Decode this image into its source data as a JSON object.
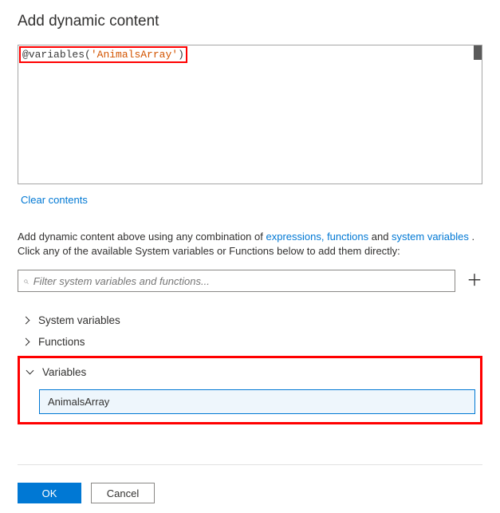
{
  "header": {
    "title": "Add dynamic content"
  },
  "editor": {
    "expression_prefix": "@",
    "expression_func": "variables",
    "expression_open": "(",
    "expression_arg": "'AnimalsArray'",
    "expression_close": ")"
  },
  "actions": {
    "clear_label": "Clear contents"
  },
  "info": {
    "text_before_links": "Add dynamic content above using any combination of ",
    "expressions_link": "expressions, functions",
    "between1": " and ",
    "sysvars_link": "system variables",
    "after_links_period": " .",
    "line2": "Click any of the available System variables or Functions below to add them directly:"
  },
  "filter": {
    "placeholder": "Filter system variables and functions..."
  },
  "categories": {
    "system_variables_label": "System variables",
    "functions_label": "Functions",
    "variables_label": "Variables",
    "variable_items": [
      {
        "name": "AnimalsArray"
      }
    ]
  },
  "buttons": {
    "ok": "OK",
    "cancel": "Cancel"
  }
}
